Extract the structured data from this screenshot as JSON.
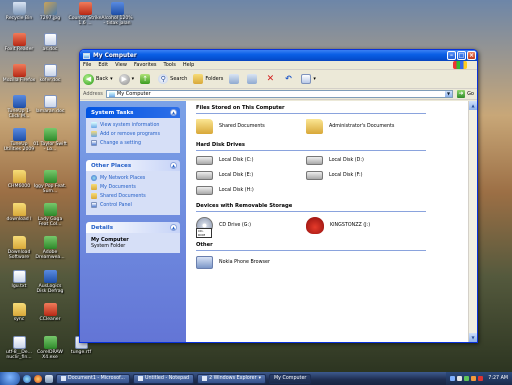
{
  "desktop": {
    "icons": [
      {
        "label": "Recycle Bin"
      },
      {
        "label": "7297.jpg"
      },
      {
        "label": "Counter Strike 1.6 ..."
      },
      {
        "label": "Alcohol 120% - tidak jalan"
      },
      {
        "label": "Foxit Reader"
      },
      {
        "label": "as.doc"
      },
      {
        "label": "Mozilla Firefox"
      },
      {
        "label": "kofer.doc"
      },
      {
        "label": "TuneUp 1-Click M..."
      },
      {
        "label": "lamaran.doc"
      },
      {
        "label": "TuneUp Utilities 2009"
      },
      {
        "label": "01 Taylor Swift - Lo..."
      },
      {
        "label": "CHM6000"
      },
      {
        "label": "Iggy Pop Feat. Sum..."
      },
      {
        "label": "download I"
      },
      {
        "label": "Lady Gaga Feat Col..."
      },
      {
        "label": "Download Software"
      },
      {
        "label": "Adobe Dreamwea..."
      },
      {
        "label": "lgu.txt"
      },
      {
        "label": "AusLogics Disk Defrag"
      },
      {
        "label": "sync"
      },
      {
        "label": "CCleaner"
      },
      {
        "label": "utf-8__De... nuclir_fin..."
      },
      {
        "label": "CorelDRAW X4.exe"
      },
      {
        "label": "tunge.rtf"
      }
    ]
  },
  "window": {
    "title": "My Computer",
    "menu": [
      "File",
      "Edit",
      "View",
      "Favorites",
      "Tools",
      "Help"
    ],
    "toolbar": {
      "back": "Back",
      "search": "Search",
      "folders": "Folders"
    },
    "address": {
      "label": "Address",
      "value": "My Computer",
      "go": "Go"
    }
  },
  "left_pane": {
    "system_tasks": {
      "title": "System Tasks",
      "items": [
        "View system information",
        "Add or remove programs",
        "Change a setting"
      ]
    },
    "other_places": {
      "title": "Other Places",
      "items": [
        "My Network Places",
        "My Documents",
        "Shared Documents",
        "Control Panel"
      ]
    },
    "details": {
      "title": "Details",
      "name": "My Computer",
      "sub": "System Folder"
    }
  },
  "right_pane": {
    "sections": [
      {
        "title": "Files Stored on This Computer",
        "items": [
          {
            "label": "Shared Documents",
            "icon": "folder"
          },
          {
            "label": "Administrator's Documents",
            "icon": "folder"
          }
        ]
      },
      {
        "title": "Hard Disk Drives",
        "items": [
          {
            "label": "Local Disk (C:)",
            "icon": "disk"
          },
          {
            "label": "Local Disk (D:)",
            "icon": "disk"
          },
          {
            "label": "Local Disk (E:)",
            "icon": "disk"
          },
          {
            "label": "Local Disk (F:)",
            "icon": "disk"
          },
          {
            "label": "Local Disk (H:)",
            "icon": "disk"
          }
        ]
      },
      {
        "title": "Devices with Removable Storage",
        "items": [
          {
            "label": "CD Drive (G:)",
            "icon": "cd",
            "badge": "CD-ROM"
          },
          {
            "label": "KINGSTONZZ (J:)",
            "icon": "devil"
          }
        ]
      },
      {
        "title": "Other",
        "items": [
          {
            "label": "Nokia Phone Browser",
            "icon": "nokia"
          }
        ]
      }
    ]
  },
  "taskbar": {
    "tasks": [
      "Document1 - Microsof...",
      "Untitled - Notepad",
      "2 Windows Explorer",
      "My Computer"
    ],
    "clock": "7:27 AM"
  }
}
